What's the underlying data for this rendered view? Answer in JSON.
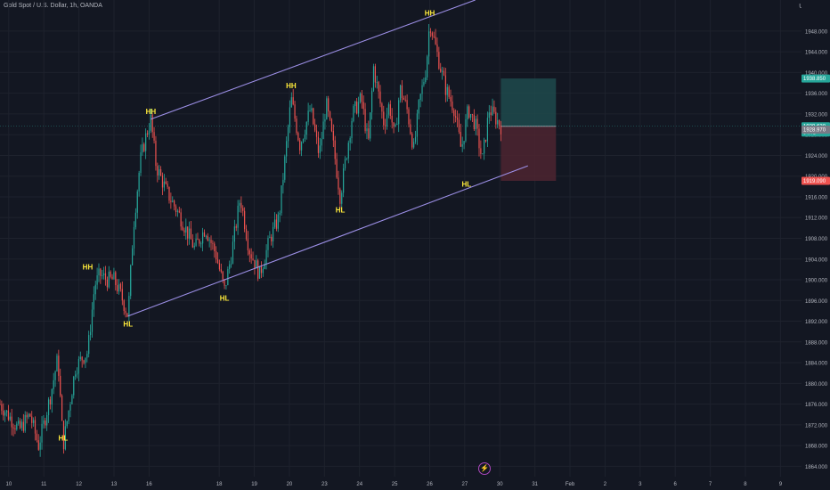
{
  "header": {
    "symbol_line": "Gold Spot / U.S. Dollar, 1h, OANDA"
  },
  "axis_currency": "USD",
  "timeline_icon": "lightning-icon",
  "colors": {
    "background": "#131722",
    "up": "#26a69a",
    "down": "#ef5350",
    "channel": "#9c8fe6",
    "label": "#ffeb3b",
    "target_zone": "#1e4a4c",
    "stop_zone": "#4d2530",
    "axis_text": "#b2b5be"
  },
  "chart_data": {
    "type": "candlestick",
    "title": "Gold Spot / U.S. Dollar, 1h, OANDA",
    "ylim": [
      1862,
      1954
    ],
    "y_ticks": [
      1864,
      1868,
      1872,
      1876,
      1880,
      1884,
      1888,
      1892,
      1896,
      1900,
      1904,
      1908,
      1912,
      1916,
      1920,
      1924,
      1928,
      1932,
      1936,
      1940,
      1944,
      1948
    ],
    "x_ticks": [
      {
        "label": "10",
        "x": 9
      },
      {
        "label": "11",
        "x": 10
      },
      {
        "label": "12",
        "x": 11
      },
      {
        "label": "13",
        "x": 12
      },
      {
        "label": "16",
        "x": 13
      },
      {
        "label": "18",
        "x": 15
      },
      {
        "label": "19",
        "x": 16
      },
      {
        "label": "20",
        "x": 17
      },
      {
        "label": "23",
        "x": 18
      },
      {
        "label": "24",
        "x": 19
      },
      {
        "label": "25",
        "x": 20
      },
      {
        "label": "26",
        "x": 21
      },
      {
        "label": "27",
        "x": 22
      },
      {
        "label": "30",
        "x": 23
      },
      {
        "label": "31",
        "x": 24
      },
      {
        "label": "Feb",
        "x": 25
      },
      {
        "label": "2",
        "x": 26
      },
      {
        "label": "3",
        "x": 27
      },
      {
        "label": "6",
        "x": 28
      },
      {
        "label": "7",
        "x": 29
      },
      {
        "label": "8",
        "x": 30
      },
      {
        "label": "9",
        "x": 31
      }
    ],
    "xlim": [
      8.75,
      31.6
    ],
    "last_data_x": 23.03,
    "candle_keypoints": [
      [
        8.75,
        1876
      ],
      [
        9.3,
        1871
      ],
      [
        9.6,
        1874
      ],
      [
        9.85,
        1868
      ],
      [
        10.2,
        1878
      ],
      [
        10.4,
        1885
      ],
      [
        10.55,
        1868
      ],
      [
        10.9,
        1883
      ],
      [
        11.1,
        1885
      ],
      [
        11.25,
        1886
      ],
      [
        11.45,
        1899
      ],
      [
        11.6,
        1901
      ],
      [
        11.8,
        1900
      ],
      [
        12.0,
        1900
      ],
      [
        12.2,
        1897
      ],
      [
        12.4,
        1893
      ],
      [
        12.55,
        1910
      ],
      [
        12.75,
        1923
      ],
      [
        12.92,
        1928
      ],
      [
        13.05,
        1931
      ],
      [
        13.2,
        1922
      ],
      [
        13.5,
        1917
      ],
      [
        13.9,
        1912
      ],
      [
        14.3,
        1906
      ],
      [
        14.6,
        1910
      ],
      [
        14.9,
        1905
      ],
      [
        15.15,
        1898
      ],
      [
        15.35,
        1905
      ],
      [
        15.6,
        1916
      ],
      [
        15.85,
        1906
      ],
      [
        16.15,
        1901
      ],
      [
        16.45,
        1908
      ],
      [
        16.7,
        1912
      ],
      [
        16.9,
        1925
      ],
      [
        17.05,
        1935
      ],
      [
        17.3,
        1926
      ],
      [
        17.6,
        1933
      ],
      [
        17.85,
        1924
      ],
      [
        18.05,
        1934
      ],
      [
        18.25,
        1926
      ],
      [
        18.45,
        1916
      ],
      [
        18.6,
        1923
      ],
      [
        18.8,
        1932
      ],
      [
        19.05,
        1935
      ],
      [
        19.25,
        1926
      ],
      [
        19.4,
        1941
      ],
      [
        19.7,
        1930
      ],
      [
        19.85,
        1934
      ],
      [
        20.0,
        1927
      ],
      [
        20.15,
        1937
      ],
      [
        20.35,
        1933
      ],
      [
        20.55,
        1925
      ],
      [
        20.7,
        1934
      ],
      [
        20.9,
        1941
      ],
      [
        21.0,
        1950
      ],
      [
        21.2,
        1944
      ],
      [
        21.45,
        1937
      ],
      [
        21.7,
        1933
      ],
      [
        21.9,
        1925
      ],
      [
        22.1,
        1933
      ],
      [
        22.3,
        1930
      ],
      [
        22.5,
        1923
      ],
      [
        22.7,
        1933
      ],
      [
        22.9,
        1931
      ],
      [
        23.03,
        1929.63
      ]
    ],
    "candle_count": 300,
    "last_price": 1929.63,
    "channel_lines": [
      {
        "name": "upper",
        "from": [
          13.05,
          1931
        ],
        "to": [
          22.3,
          1954
        ]
      },
      {
        "name": "lower",
        "from": [
          12.4,
          1893
        ],
        "to": [
          23.8,
          1922
        ]
      }
    ],
    "annotations": [
      {
        "text": "HL",
        "x": 10.55,
        "y": 1869
      },
      {
        "text": "HH",
        "x": 11.25,
        "y": 1902
      },
      {
        "text": "HL",
        "x": 12.4,
        "y": 1891
      },
      {
        "text": "HH",
        "x": 13.05,
        "y": 1932
      },
      {
        "text": "HL",
        "x": 15.15,
        "y": 1896
      },
      {
        "text": "HH",
        "x": 17.05,
        "y": 1937
      },
      {
        "text": "HL",
        "x": 18.45,
        "y": 1913
      },
      {
        "text": "HH",
        "x": 21.0,
        "y": 1951
      },
      {
        "text": "HL",
        "x": 22.05,
        "y": 1918
      }
    ],
    "position": {
      "x_start": 23.03,
      "x_end": 24.6,
      "entry": 1929.63,
      "target": 1938.85,
      "stop": 1919.09
    },
    "price_labels": [
      {
        "text": "1938.850",
        "y": 1938.85,
        "color": "#26a69a"
      },
      {
        "text": "1929.630",
        "y": 1929.63,
        "color": "#26a69a",
        "sub": "04:41"
      },
      {
        "text": "1928.970",
        "y": 1928.97,
        "color": "#787b86"
      },
      {
        "text": "1919.090",
        "y": 1919.09,
        "color": "#ef5350"
      }
    ]
  }
}
